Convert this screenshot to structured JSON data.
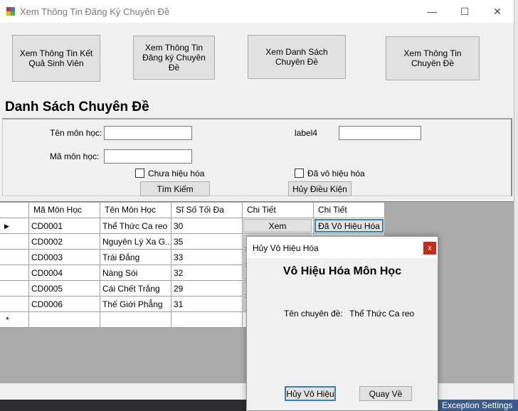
{
  "window": {
    "title": "Xem Thông Tin Đăng Ký Chuyên Đề",
    "minimize": "—",
    "maximize": "☐",
    "close": "✕"
  },
  "nav": [
    {
      "label": "Xem Thông Tin Kết Quả Sinh Viên"
    },
    {
      "label": "Xem Thông Tin Đăng ký Chuyên Đề"
    },
    {
      "label": "Xem Danh Sách Chuyên Đề"
    },
    {
      "label": "Xem Thông Tin Chuyên Đề"
    }
  ],
  "heading": "Danh Sách Chuyên Đề",
  "filters": {
    "ten_label": "Tên môn học:",
    "ten_value": "",
    "ma_label": "Mã môn học:",
    "ma_value": "",
    "label4": "label4",
    "label4_value": "",
    "chua_hieu_hoa": "Chưa hiệu hóa",
    "da_vo_hieu_hoa": "Đã vô hiệu hóa",
    "search_button": "Tìm Kiếm",
    "clear_button": "Hủy Điều Kiện"
  },
  "grid": {
    "headers": [
      "Mã Môn Học",
      "Tên Môn Học",
      "Sĩ Số Tối Đa",
      "Chi Tiết",
      "Chi Tiết"
    ],
    "rows": [
      [
        "CD0001",
        "Thể Thức Ca reo",
        "30",
        "Xem",
        "Đã Vô Hiệu Hóa"
      ],
      [
        "CD0002",
        "Nguyên  Lý Xa G...",
        "35",
        "",
        ""
      ],
      [
        "CD0003",
        "Trái Đắng",
        "33",
        "",
        ""
      ],
      [
        "CD0004",
        "Nàng Sói",
        "32",
        "",
        ""
      ],
      [
        "CD0005",
        "Cái Chết Trắng",
        "29",
        "",
        ""
      ],
      [
        "CD0006",
        "Thế Giới Phẳng",
        "31",
        "",
        ""
      ]
    ],
    "current_row_marker": "▶",
    "new_row_marker": "*"
  },
  "dialog": {
    "title": "Hủy Vô Hiệu Hóa",
    "close": "x",
    "heading": "Vô Hiệu Hóa Môn Học",
    "field_label": "Tên chuyên đề:",
    "field_value": "Thể Thức Ca reo",
    "confirm_button": "Hủy Vô Hiệu",
    "back_button": "Quay Về"
  },
  "statusbar": {
    "text": "Exception Settings"
  }
}
